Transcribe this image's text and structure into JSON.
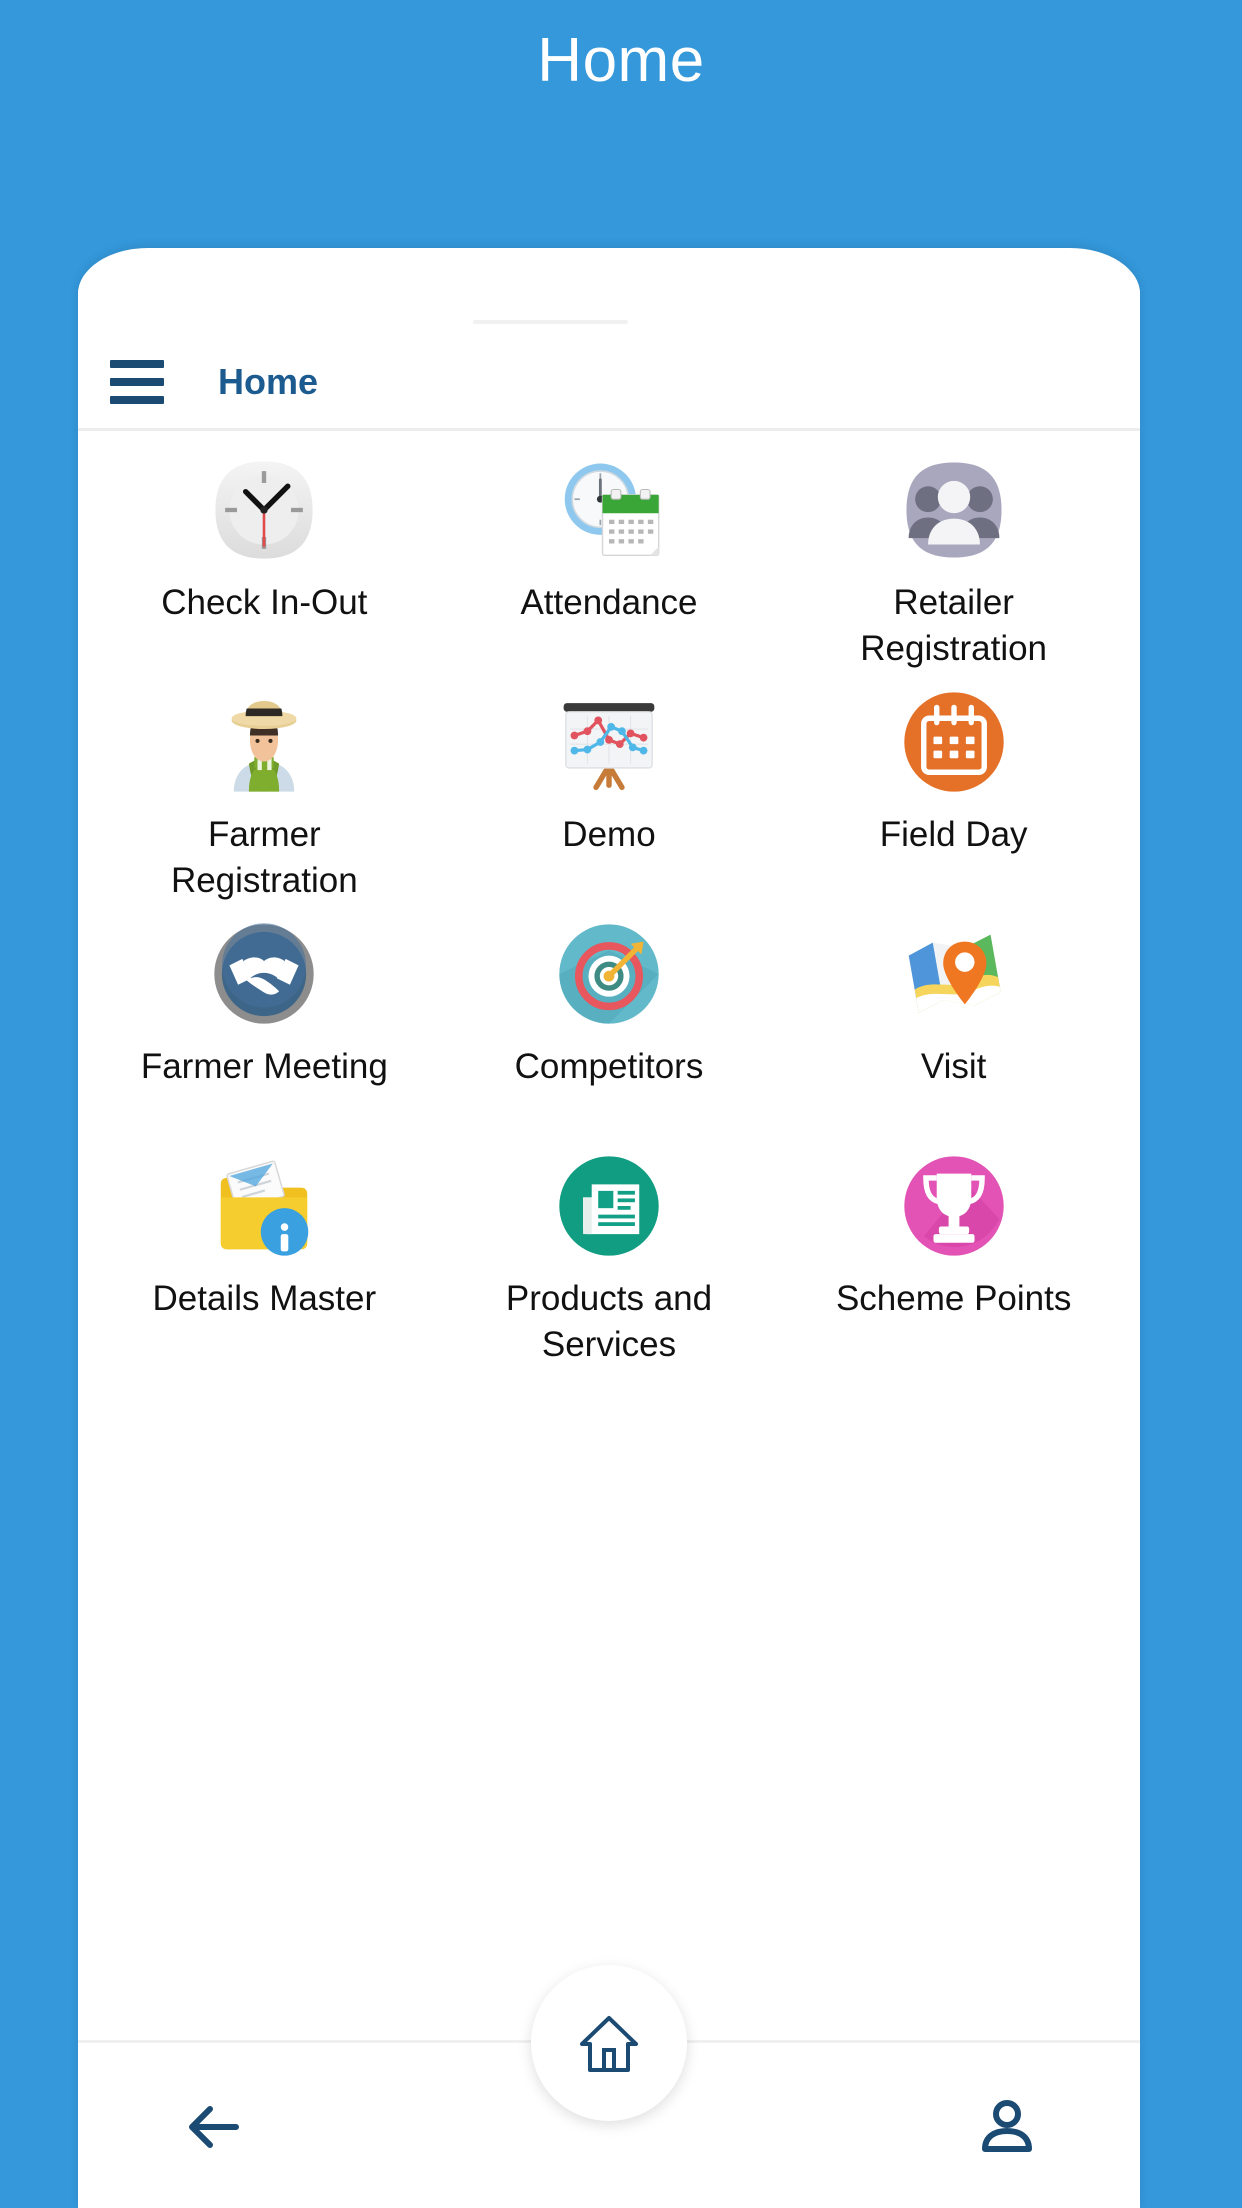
{
  "screen": {
    "title": "Home",
    "background_color": "#3498db",
    "card_color": "#ffffff"
  },
  "app_bar": {
    "menu_icon": "hamburger-menu-icon",
    "title": "Home",
    "title_color": "#1b5b8f"
  },
  "menu": {
    "items": [
      {
        "label": "Check In-Out",
        "icon": "clock-icon"
      },
      {
        "label": "Attendance",
        "icon": "clock-calendar-icon"
      },
      {
        "label": "Retailer Registration",
        "icon": "people-group-icon"
      },
      {
        "label": "Farmer Registration",
        "icon": "farmer-icon"
      },
      {
        "label": "Demo",
        "icon": "presentation-chart-icon"
      },
      {
        "label": "Field Day",
        "icon": "calendar-circle-icon"
      },
      {
        "label": "Farmer Meeting",
        "icon": "handshake-icon"
      },
      {
        "label": "Competitors",
        "icon": "target-dart-icon"
      },
      {
        "label": "Visit",
        "icon": "map-pin-icon"
      },
      {
        "label": "Details Master",
        "icon": "folder-info-icon"
      },
      {
        "label": "Products and Services",
        "icon": "newspaper-circle-icon"
      },
      {
        "label": "Scheme Points",
        "icon": "trophy-circle-icon"
      }
    ]
  },
  "bottom_nav": {
    "back_icon": "back-arrow-icon",
    "home_icon": "home-icon",
    "profile_icon": "person-icon"
  },
  "colors": {
    "brand_blue": "#3498db",
    "nav_navy": "#1b4a72",
    "field_day_orange": "#e8752a",
    "competitors_teal": "#5eb8c9",
    "products_green": "#12a186",
    "scheme_pink": "#e253b5"
  }
}
